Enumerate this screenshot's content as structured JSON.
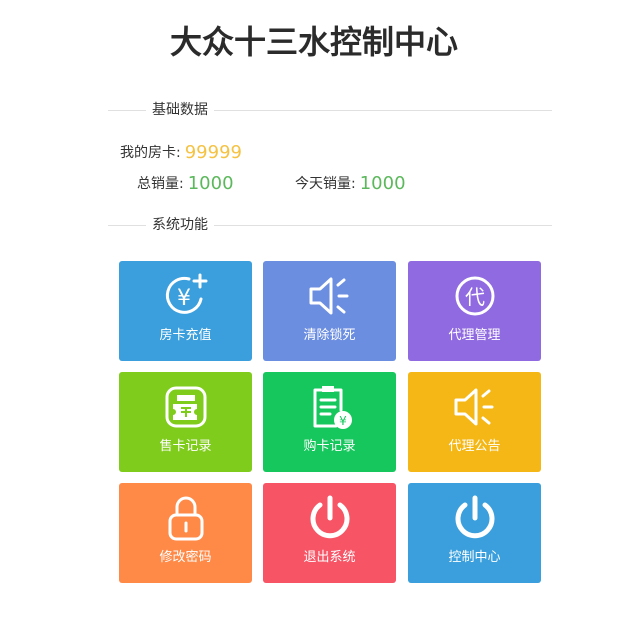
{
  "title": "大众十三水控制中心",
  "sections": {
    "basic": "基础数据",
    "functions": "系统功能"
  },
  "stats": {
    "room_card_label": "我的房卡:",
    "room_card_value": "99999",
    "total_sales_label": "总销量:",
    "total_sales_value": "1000",
    "today_sales_label": "今天销量:",
    "today_sales_value": "1000"
  },
  "colors": {
    "room_card_value": "#f5c242",
    "sales_value": "#5cb85c"
  },
  "tiles": [
    {
      "label": "房卡充值",
      "icon": "yuan-plus-icon",
      "color": "#3a9fdc"
    },
    {
      "label": "清除锁死",
      "icon": "speaker-icon",
      "color": "#6c8ee0"
    },
    {
      "label": "代理管理",
      "icon": "agent-circle-icon",
      "color": "#8f6ae0"
    },
    {
      "label": "售卡记录",
      "icon": "ticket-icon",
      "color": "#7fcc1c"
    },
    {
      "label": "购卡记录",
      "icon": "receipt-yuan-icon",
      "color": "#15c75c"
    },
    {
      "label": "代理公告",
      "icon": "speaker-icon",
      "color": "#f5b716"
    },
    {
      "label": "修改密码",
      "icon": "lock-icon",
      "color": "#ff8a48"
    },
    {
      "label": "退出系统",
      "icon": "power-icon",
      "color": "#f75466"
    },
    {
      "label": "控制中心",
      "icon": "power-icon",
      "color": "#3a9fdc"
    }
  ],
  "icon_text": {
    "agent": "代",
    "yuan": "¥"
  }
}
